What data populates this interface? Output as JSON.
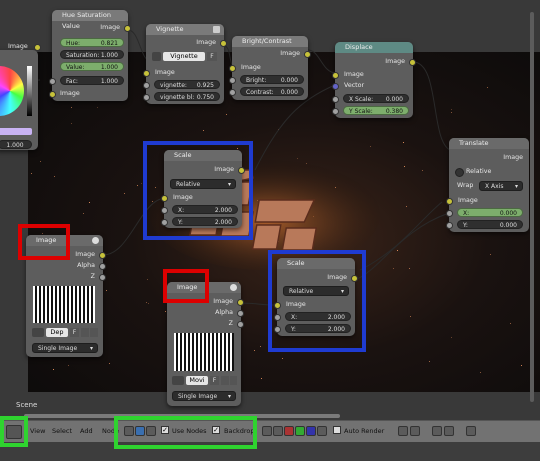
{
  "window": {
    "scene_label": "Scene"
  },
  "nodes": {
    "hue_saturation": {
      "title": "Hue Saturation Value",
      "output": "Image",
      "fields": [
        {
          "label": "Hue:",
          "value": "0.821"
        },
        {
          "label": "Saturation:",
          "value": "1.000"
        },
        {
          "label": "Value:",
          "value": "1.000"
        },
        {
          "label": "Fac:",
          "value": "1.000"
        }
      ],
      "input": "Image"
    },
    "left_partial": {
      "output": "Image",
      "value": "1.000"
    },
    "vignette": {
      "title": "Vignette",
      "output": "Image",
      "group_name": "Vignette",
      "group_user": "F",
      "input": "Image",
      "fields": [
        {
          "label": "vignette:",
          "value": "0.925"
        },
        {
          "label": "vignette bl:",
          "value": "0.750"
        }
      ]
    },
    "bright_contrast": {
      "title": "Bright/Contrast",
      "output": "Image",
      "input": "Image",
      "fields": [
        {
          "label": "Bright:",
          "value": "0.000"
        },
        {
          "label": "Contrast:",
          "value": "0.000"
        }
      ]
    },
    "displace": {
      "title": "Displace",
      "output": "Image",
      "inputs": [
        "Image",
        "Vector"
      ],
      "fields": [
        {
          "label": "X Scale:",
          "value": "0.000"
        },
        {
          "label": "Y Scale:",
          "value": "0.380"
        }
      ]
    },
    "translate": {
      "title": "Translate",
      "output": "Image",
      "relative": "Relative",
      "wrap_label": "Wrap",
      "wrap_value": "X Axis",
      "input": "Image",
      "fields": [
        {
          "label": "X:",
          "value": "0.000"
        },
        {
          "label": "Y:",
          "value": "0.000"
        }
      ]
    },
    "scale1": {
      "title": "Scale",
      "output": "Image",
      "space": "Relative",
      "input": "Image",
      "fields": [
        {
          "label": "X:",
          "value": "2.000"
        },
        {
          "label": "Y:",
          "value": "2.000"
        }
      ]
    },
    "scale2": {
      "title": "Scale",
      "output": "Image",
      "space": "Relative",
      "input": "Image",
      "fields": [
        {
          "label": "X:",
          "value": "2.000"
        },
        {
          "label": "Y:",
          "value": "2.000"
        }
      ]
    },
    "image1": {
      "title": "Image",
      "outputs": [
        "Image",
        "Alpha",
        "Z"
      ],
      "datablock": "Dep",
      "user": "F",
      "source": "Single Image"
    },
    "image2": {
      "title": "Image",
      "outputs": [
        "Image",
        "Alpha",
        "Z"
      ],
      "datablock": "Movi",
      "user": "F",
      "source": "Single Image"
    }
  },
  "header": {
    "menus": [
      "View",
      "Select",
      "Add",
      "Node"
    ],
    "use_nodes_label": "Use Nodes",
    "backdrop_label": "Backdrop",
    "auto_render_label": "Auto Render"
  },
  "colors": {
    "highlight_red": "#dd0000",
    "highlight_blue": "#1f3bd1",
    "highlight_green": "#2fd32f",
    "field_green": "#7dae6c"
  }
}
